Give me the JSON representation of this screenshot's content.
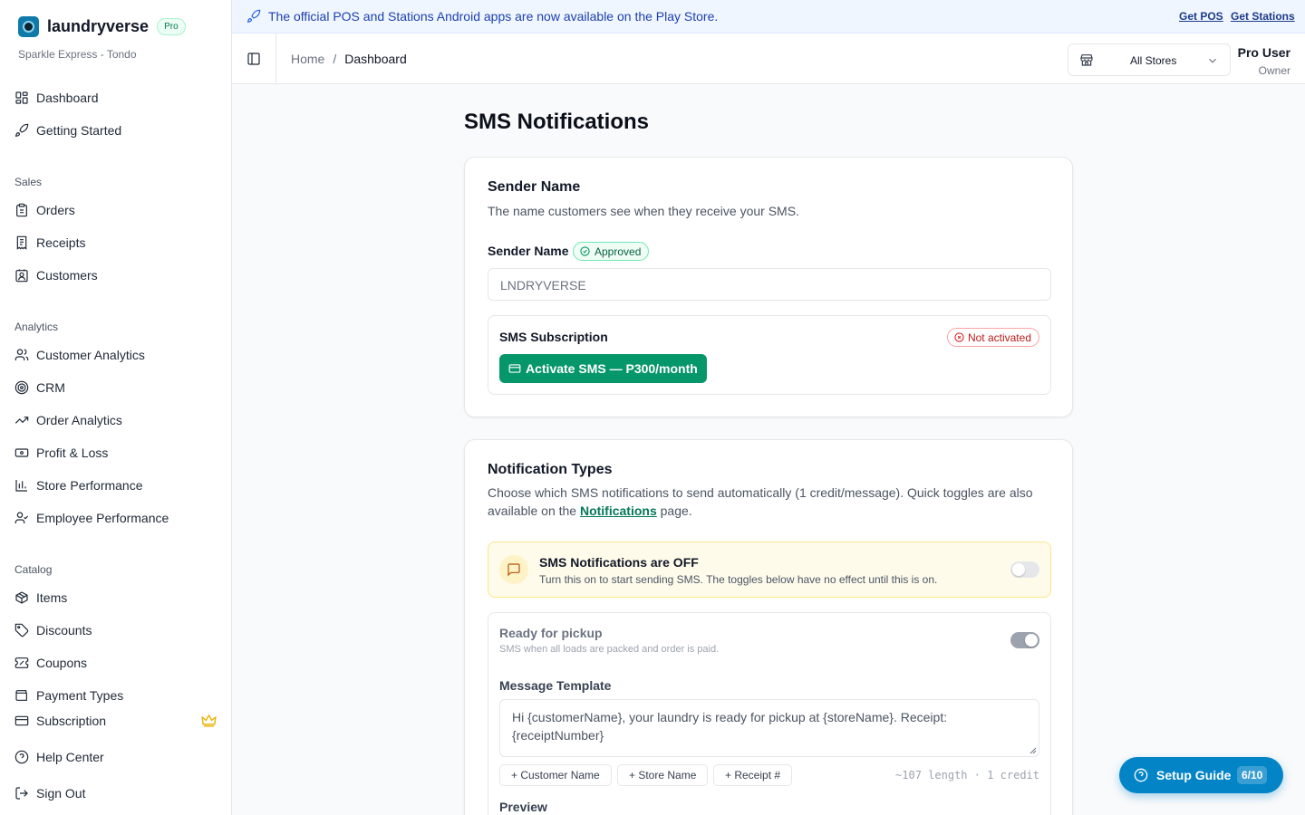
{
  "brand": {
    "name": "laundryverse",
    "badge": "Pro",
    "store": "Sparkle Express - Tondo"
  },
  "sidebar": {
    "top": [
      {
        "label": "Dashboard",
        "icon": "dashboard-icon"
      },
      {
        "label": "Getting Started",
        "icon": "rocket-icon"
      }
    ],
    "sales_heading": "Sales",
    "sales": [
      {
        "label": "Orders",
        "icon": "clipboard-icon"
      },
      {
        "label": "Receipts",
        "icon": "receipt-icon"
      },
      {
        "label": "Customers",
        "icon": "contact-icon"
      }
    ],
    "analytics_heading": "Analytics",
    "analytics": [
      {
        "label": "Customer Analytics",
        "icon": "users-icon"
      },
      {
        "label": "CRM",
        "icon": "target-icon"
      },
      {
        "label": "Order Analytics",
        "icon": "trend-icon"
      },
      {
        "label": "Profit & Loss",
        "icon": "banknote-icon"
      },
      {
        "label": "Store Performance",
        "icon": "bar-chart-icon"
      },
      {
        "label": "Employee Performance",
        "icon": "user-check-icon"
      }
    ],
    "catalog_heading": "Catalog",
    "catalog": [
      {
        "label": "Items",
        "icon": "package-icon"
      },
      {
        "label": "Discounts",
        "icon": "tag-icon"
      },
      {
        "label": "Coupons",
        "icon": "ticket-icon"
      },
      {
        "label": "Payment Types",
        "icon": "wallet-icon"
      }
    ],
    "bottom": [
      {
        "label": "Subscription",
        "icon": "credit-card-icon"
      },
      {
        "label": "Help Center",
        "icon": "help-icon"
      },
      {
        "label": "Sign Out",
        "icon": "logout-icon"
      }
    ]
  },
  "announcement": {
    "text": "The official POS and Stations Android apps are now available on the Play Store.",
    "link_pos": "Get POS",
    "link_stations": "Get Stations"
  },
  "header": {
    "breadcrumb_home": "Home",
    "breadcrumb_sep": "/",
    "breadcrumb_current": "Dashboard",
    "store_select": "All Stores",
    "user_name": "Pro User",
    "user_role": "Owner"
  },
  "page": {
    "title": "SMS Notifications"
  },
  "sender_card": {
    "title": "Sender Name",
    "desc": "The name customers see when they receive your SMS.",
    "field_label": "Sender Name",
    "status": "Approved",
    "value": "LNDRYVERSE",
    "subscription_title": "SMS Subscription",
    "subscription_status": "Not activated",
    "activate_label": "Activate SMS — P300/month"
  },
  "types_card": {
    "title": "Notification Types",
    "desc_before": "Choose which SMS notifications to send automatically (1 credit/message). Quick toggles are also available on the ",
    "desc_link": "Notifications",
    "desc_after": " page.",
    "master_title": "SMS Notifications are OFF",
    "master_desc": "Turn this on to start sending SMS. The toggles below have no effect until this is on.",
    "master_on": false,
    "pickup_title": "Ready for pickup",
    "pickup_desc": "SMS when all loads are packed and order is paid.",
    "pickup_on": true,
    "template_label": "Message Template",
    "template_value": "Hi {customerName}, your laundry is ready for pickup at {storeName}. Receipt: {receiptNumber}",
    "chips": [
      "+ Customer Name",
      "+ Store Name",
      "+ Receipt #"
    ],
    "length_text": "~107 length · 1 credit",
    "preview_label": "Preview"
  },
  "setup_guide": {
    "label": "Setup Guide",
    "count": "6/10"
  },
  "colors": {
    "brand_green": "#059669",
    "accent_blue": "#0284c7",
    "warning_bg": "#fffbeb",
    "danger": "#b91c1c"
  }
}
